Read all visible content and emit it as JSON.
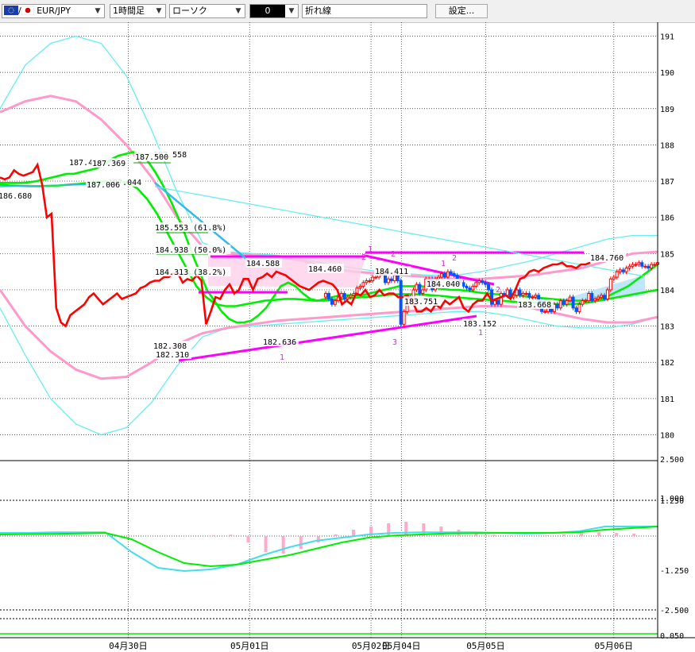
{
  "toolbar": {
    "symbol": "EUR/JPY",
    "symbol_prefix": "/",
    "timeframe": "1時間足",
    "chart_style": "ローソク",
    "overlay_value": "0",
    "line_type": "折れ線",
    "settings_label": "設定..."
  },
  "icons": {
    "eu_flag": "eu-flag-icon",
    "jp_flag": "jp-flag-icon",
    "dropdown": "chevron-down-icon"
  },
  "colors": {
    "price_line": "#ff0000",
    "ma_green": "#00ee00",
    "bb_pink": "#ff99cc",
    "bb_cyan": "#66eeee",
    "trend_magenta": "#ff00ff",
    "trend_blue": "#33bbee",
    "candle_up": "#ff0000",
    "candle_down": "#0055ff",
    "cloud": "#ffd0e8",
    "cloud_blue": "#b8e4f8"
  },
  "chart_data": [
    {
      "type": "line",
      "panel": "price",
      "y_ticks": [
        "191",
        "190",
        "189",
        "188",
        "187",
        "186",
        "185",
        "184",
        "183",
        "182",
        "181",
        "180"
      ],
      "ylim": [
        179.7,
        191.2
      ],
      "x_ticks": [
        "04月30日",
        "05月01日",
        "05月02日",
        "05月04日",
        "05月05日",
        "05月06日"
      ],
      "x_tick_index": [
        20,
        56,
        92,
        101,
        126,
        164
      ],
      "x_range": [
        -18,
        177
      ],
      "series": [
        {
          "key": "close",
          "values": [
            187.1,
            187.05,
            187.1,
            187.3,
            187.2,
            187.15,
            187.2,
            187.25,
            187.45,
            186.9,
            186.0,
            186.1,
            183.5,
            183.1,
            183.0,
            183.3,
            183.4,
            183.5,
            183.6,
            183.8,
            183.9,
            183.75,
            183.6,
            183.7,
            183.8,
            183.9,
            183.75,
            183.8,
            183.85,
            183.9,
            184.05,
            184.1,
            184.2,
            184.25,
            184.25,
            184.35,
            184.35,
            184.45,
            184.45,
            184.2,
            184.3,
            184.25,
            184.4,
            184.25,
            183.05,
            183.4,
            183.8,
            183.75,
            184.0,
            184.15,
            183.9,
            184.0,
            184.3,
            184.3,
            184.0,
            184.3,
            184.35,
            184.45,
            184.35,
            184.5,
            184.45,
            184.4,
            184.3,
            184.2,
            184.1,
            184.05,
            184.0,
            184.1,
            184.2,
            184.25,
            184.2,
            184.15,
            184.0,
            183.6,
            183.7,
            183.6,
            183.9,
            183.85,
            184.0,
            183.8,
            183.85,
            184.0,
            183.85,
            183.9,
            183.9,
            183.8,
            183.8,
            183.85,
            183.7,
            183.4,
            183.4,
            183.5,
            183.4,
            183.6,
            183.5,
            183.7,
            183.6,
            183.7,
            183.8,
            183.5,
            183.4,
            183.6,
            183.7,
            183.7,
            183.9,
            183.7,
            183.75,
            183.8,
            183.85,
            183.75,
            184.0,
            184.3,
            184.35,
            184.5,
            184.55,
            184.5,
            184.6,
            184.65,
            184.7,
            184.7,
            184.75,
            184.65,
            184.65,
            184.6,
            184.7,
            184.7,
            184.75
          ]
        },
        {
          "key": "ma_fast",
          "values": [
            186.95,
            186.95,
            186.95,
            186.95,
            186.97,
            187.0,
            187.05,
            187.1,
            187.15,
            187.2,
            187.2,
            187.25,
            187.3,
            187.35,
            187.45,
            187.6,
            187.7,
            187.75,
            187.8,
            187.75,
            187.55,
            187.25,
            186.9,
            186.5,
            186.05,
            185.55,
            185.0,
            184.5,
            184.0,
            183.7,
            183.4,
            183.2,
            183.1,
            183.1,
            183.15,
            183.3,
            183.5,
            183.8,
            184.1,
            184.2,
            184.1,
            183.9,
            183.75,
            183.7,
            183.75,
            183.8,
            183.85,
            183.85,
            183.85,
            183.85,
            183.9,
            183.95,
            184.0,
            184.05,
            184.1,
            184.1,
            184.1,
            184.1,
            184.08,
            184.05,
            184.02,
            184.0,
            184.0,
            183.98,
            183.95,
            183.92,
            183.9,
            183.88,
            183.87,
            183.86,
            183.85,
            183.82,
            183.8,
            183.78,
            183.76,
            183.74,
            183.72,
            183.7,
            183.7,
            183.7,
            183.72,
            183.75,
            183.8,
            183.9,
            184.0,
            184.1,
            184.25,
            184.4,
            184.55,
            184.7
          ]
        },
        {
          "key": "ma_slow",
          "values": [
            186.9,
            186.88,
            186.87,
            186.86,
            186.86,
            186.87,
            186.88,
            186.9,
            186.92,
            186.95,
            186.97,
            187.0,
            187.0,
            186.95,
            186.8,
            186.5,
            186.1,
            185.6,
            185.1,
            184.6,
            184.1,
            183.8,
            183.6,
            183.55,
            183.55,
            183.6,
            183.65,
            183.7,
            183.72,
            183.75,
            183.75,
            183.73,
            183.7,
            183.7,
            183.72,
            183.75,
            183.78,
            183.8,
            183.82,
            183.85,
            183.87,
            183.88,
            183.88,
            183.87,
            183.85,
            183.83,
            183.8,
            183.78,
            183.76,
            183.74,
            183.72,
            183.7,
            183.68,
            183.66,
            183.65,
            183.64,
            183.62,
            183.6,
            183.6,
            183.62,
            183.65,
            183.7,
            183.75,
            183.8,
            183.85,
            183.9,
            183.95,
            184.0
          ]
        },
        {
          "key": "bb_upper_2",
          "values": [
            188.9,
            189.2,
            189.35,
            189.2,
            188.7,
            188.0,
            187.1,
            186.0,
            185.2,
            185.0,
            184.95,
            184.9,
            184.8,
            184.6,
            184.5,
            184.45,
            184.4,
            184.35,
            184.3,
            184.3,
            184.35,
            184.4,
            184.5,
            184.6,
            184.8,
            185.0,
            185.05
          ]
        },
        {
          "key": "bb_lower_2",
          "values": [
            184.0,
            183.0,
            182.3,
            181.8,
            181.55,
            181.6,
            182.0,
            182.5,
            182.8,
            182.95,
            183.05,
            183.15,
            183.2,
            183.25,
            183.3,
            183.35,
            183.4,
            183.45,
            183.5,
            183.55,
            183.55,
            183.5,
            183.35,
            183.2,
            183.1,
            183.1,
            183.25
          ]
        },
        {
          "key": "bb_upper_3",
          "values": [
            189.0,
            190.2,
            190.8,
            191.0,
            190.8,
            189.9,
            188.4,
            186.7,
            185.3,
            185.05,
            185.0,
            184.95,
            184.85,
            184.7,
            184.6,
            184.5,
            184.45,
            184.4,
            184.4,
            184.5,
            184.65,
            184.8,
            185.0,
            185.2,
            185.4,
            185.5,
            185.5
          ]
        },
        {
          "key": "bb_lower_3",
          "values": [
            183.5,
            182.2,
            181.0,
            180.3,
            180.0,
            180.2,
            180.9,
            181.9,
            182.7,
            182.95,
            183.0,
            183.05,
            183.1,
            183.15,
            183.2,
            183.25,
            183.3,
            183.35,
            183.4,
            183.4,
            183.3,
            183.15,
            183.0,
            182.95,
            182.95,
            183.05,
            183.25
          ]
        }
      ],
      "annotations": [
        "187.416",
        "187.369",
        "187.044",
        "187.006",
        "187.558",
        "187.500",
        "186.680",
        "185.553 (61.8%)",
        "184.938 (50.0%)",
        "184.313 (38.2%)",
        "184.588",
        "184.460",
        "184.411",
        "184.040",
        "183.751",
        "183.668",
        "184.760",
        "183.152",
        "182.636",
        "182.308",
        "182.310"
      ],
      "wave_labels": [
        "1",
        "2",
        "1",
        "2",
        "3",
        "1",
        "2",
        "1",
        "2"
      ]
    },
    {
      "type": "line",
      "panel": "macd",
      "y_ticks": [
        "2.500",
        "1.000",
        "1.250",
        "-1.250",
        "-2.500"
      ],
      "series": [
        {
          "key": "macd",
          "values": [
            0.1,
            0.1,
            0.12,
            0.12,
            0.12,
            -0.5,
            -1.0,
            -1.1,
            -1.05,
            -0.9,
            -0.6,
            -0.35,
            -0.15,
            -0.05,
            0.05,
            0.1,
            0.12,
            0.12,
            0.12,
            0.1,
            0.08,
            0.1,
            0.15,
            0.3,
            0.3,
            0.3
          ]
        },
        {
          "key": "signal",
          "values": [
            0.05,
            0.06,
            0.07,
            0.08,
            0.1,
            -0.1,
            -0.5,
            -0.85,
            -0.95,
            -0.9,
            -0.75,
            -0.6,
            -0.4,
            -0.2,
            -0.05,
            0.02,
            0.05,
            0.08,
            0.09,
            0.1,
            0.1,
            0.1,
            0.12,
            0.2,
            0.25,
            0.3
          ]
        },
        {
          "key": "histogram",
          "values": [
            0,
            0.02,
            0.04,
            -0.2,
            -0.5,
            -0.55,
            -0.4,
            -0.2,
            0.05,
            0.2,
            0.3,
            0.4,
            0.45,
            0.4,
            0.3,
            0.2,
            0.1,
            0.04,
            0.02,
            0.0,
            0.02,
            0.05,
            0.1,
            0.12,
            0.1,
            0.08
          ]
        }
      ]
    },
    {
      "type": "line",
      "panel": "lower",
      "y_ticks": [
        "0.050"
      ],
      "series": [
        {
          "key": "indicator",
          "values": [
            0.05,
            0.05,
            0.05,
            0.05,
            0.05,
            0.05,
            0.05
          ]
        }
      ]
    }
  ]
}
